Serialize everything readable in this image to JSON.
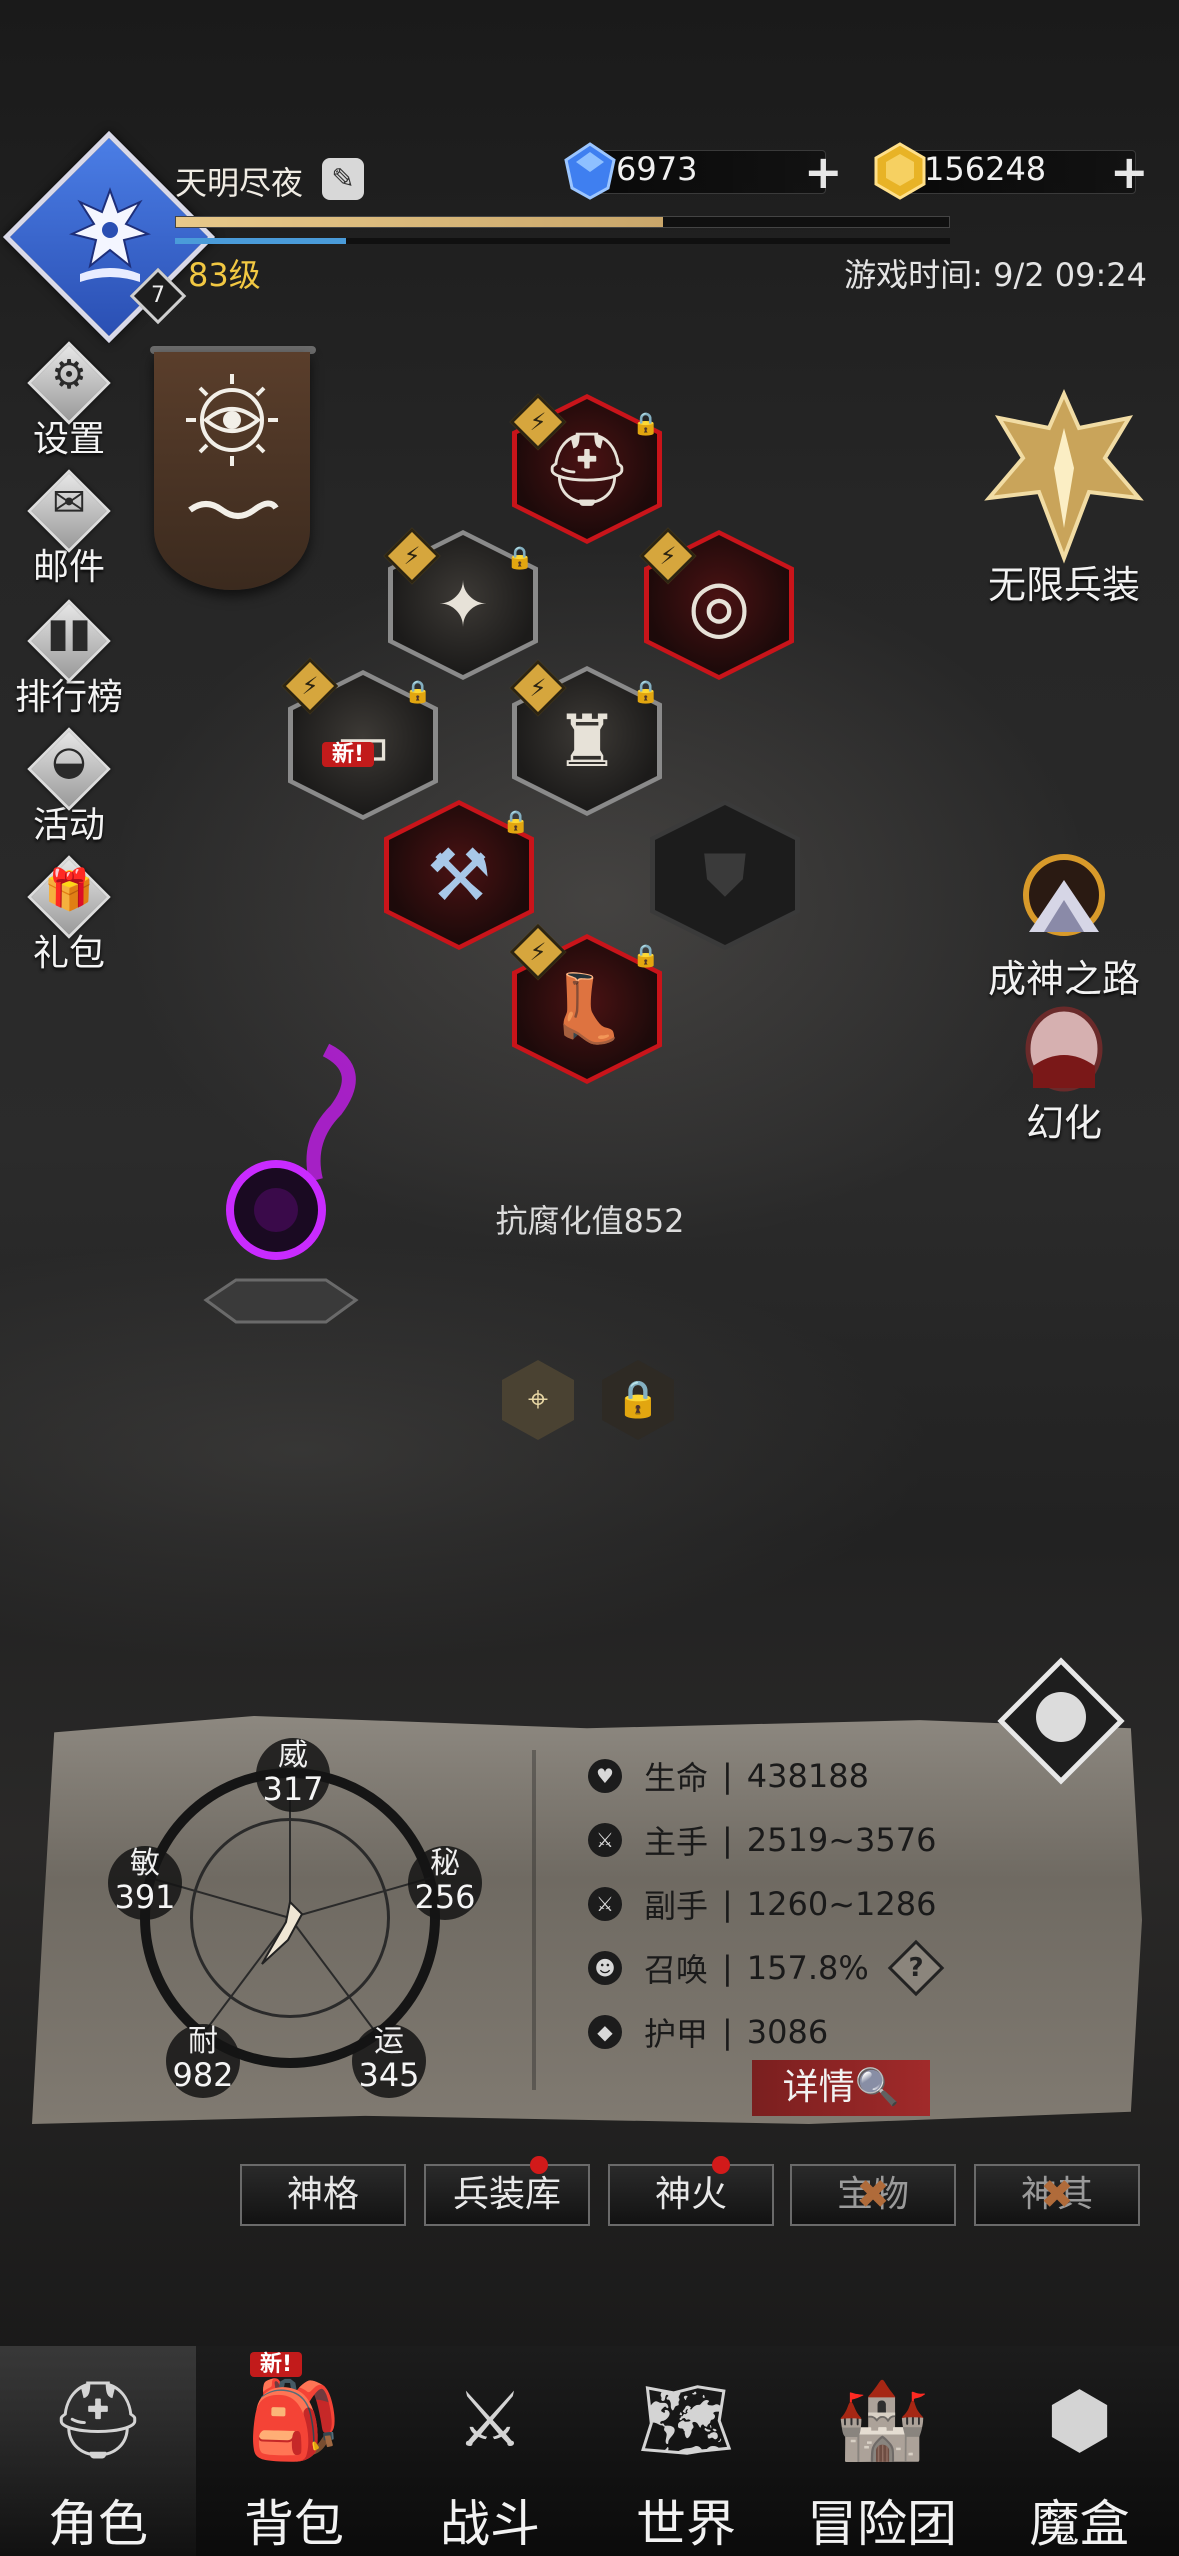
{
  "player": {
    "name": "天明尽夜",
    "level_text": "83级",
    "badge_level": "7",
    "exp_progress": 0.63,
    "mp_progress": 0.22
  },
  "currency": {
    "diamonds": "6973",
    "gold": "156248"
  },
  "game_time": "游戏时间: 9/2 09:24",
  "left_menu": [
    {
      "label": "设置",
      "icon": "gear-icon"
    },
    {
      "label": "邮件",
      "icon": "mail-icon"
    },
    {
      "label": "排行榜",
      "icon": "ranking-icon"
    },
    {
      "label": "活动",
      "icon": "event-icon"
    },
    {
      "label": "礼包",
      "icon": "gift-icon"
    }
  ],
  "right_menu": [
    {
      "label": "无限兵装",
      "icon": "infinite-arms-icon"
    },
    {
      "label": "成神之路",
      "icon": "ascension-icon"
    },
    {
      "label": "幻化",
      "icon": "transmog-icon"
    }
  ],
  "equipment": {
    "new_tag": "新!"
  },
  "corruption_text": "抗腐化值852",
  "attributes": {
    "wei": {
      "name": "威",
      "value": "317"
    },
    "mi": {
      "name": "秘",
      "value": "256"
    },
    "min": {
      "name": "敏",
      "value": "391"
    },
    "nai": {
      "name": "耐",
      "value": "982"
    },
    "yun": {
      "name": "运",
      "value": "345"
    }
  },
  "stats": [
    {
      "label": "生命",
      "value": "438188",
      "icon": "heart-icon"
    },
    {
      "label": "主手",
      "value": "2519~3576",
      "icon": "main-hand-icon"
    },
    {
      "label": "副手",
      "value": "1260~1286",
      "icon": "off-hand-icon"
    },
    {
      "label": "召唤",
      "value": "157.8%",
      "icon": "summon-icon"
    },
    {
      "label": "护甲",
      "value": "3086",
      "icon": "armor-icon"
    }
  ],
  "stat_separator": "|",
  "details_label": "详情",
  "tabs": [
    {
      "label": "神格",
      "locked": false,
      "badge": false
    },
    {
      "label": "兵装库",
      "locked": false,
      "badge": true
    },
    {
      "label": "神火",
      "locked": false,
      "badge": true
    },
    {
      "label": "宝物",
      "locked": true,
      "badge": false
    },
    {
      "label": "神其",
      "locked": true,
      "badge": false
    }
  ],
  "bottom_nav": [
    {
      "label": "角色",
      "icon": "helmet-icon",
      "active": true
    },
    {
      "label": "背包",
      "icon": "backpack-icon",
      "active": false,
      "tag": "新!"
    },
    {
      "label": "战斗",
      "icon": "sword-shield-icon",
      "active": false
    },
    {
      "label": "世界",
      "icon": "map-icon",
      "active": false
    },
    {
      "label": "冒险团",
      "icon": "castle-icon",
      "active": false
    },
    {
      "label": "魔盒",
      "icon": "cube-icon",
      "active": false
    }
  ],
  "colors": {
    "gold": "#f2c842",
    "exp_bar": "#e8c98a",
    "mp_bar": "#4a9bd9",
    "epic_red": "#c9141a",
    "avatar_blue": "#3a66d0"
  }
}
